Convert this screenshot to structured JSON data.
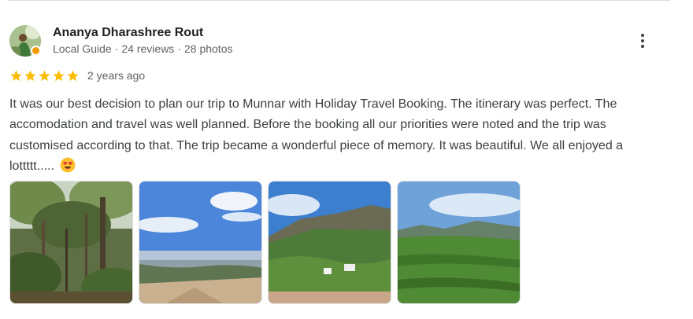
{
  "review": {
    "author": {
      "name": "Ananya Dharashree Rout",
      "role": "Local Guide",
      "reviews": "24 reviews",
      "photos": "28 photos",
      "separator": "·",
      "avatar_icon": "profile-photo",
      "badge_icon": "local-guide-badge"
    },
    "rating": 5,
    "rating_max": 5,
    "time_ago": "2 years ago",
    "text": "It was our best decision to plan our trip to Munnar with Holiday Travel Booking. The itinerary was perfect. The accomodation and travel was well planned. Before the booking all our priorities were noted and the trip was customised according to that. The trip became a wonderful piece of memory. It was beautiful. We all enjoyed a lottttt.....",
    "text_emoji": "smiling-face-with-heart-eyes",
    "more_icon": "more-vert-icon",
    "photos": [
      {
        "subject": "forest trees"
      },
      {
        "subject": "sky and valley view"
      },
      {
        "subject": "hills with tea plantation"
      },
      {
        "subject": "tea plantation and mountains"
      }
    ]
  },
  "colors": {
    "star": "#fbbc04",
    "name": "#202124",
    "meta": "#5f6368",
    "body": "#3c4043",
    "divider": "#dadce0",
    "badge": "#f29900"
  }
}
